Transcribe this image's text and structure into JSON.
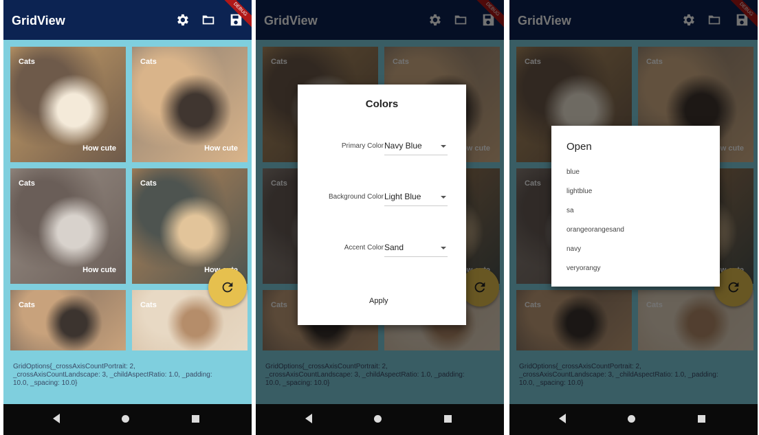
{
  "app": {
    "title": "GridView",
    "debug_banner": "DEBUG"
  },
  "grid": {
    "tiles": [
      {
        "caption_top": "Cats",
        "caption_bottom": "How cute",
        "colors": [
          "#c9a16a",
          "#6e5a4a",
          "#f4ead9"
        ]
      },
      {
        "caption_top": "Cats",
        "caption_bottom": "How cute",
        "colors": [
          "#8f8072",
          "#d9b48a",
          "#403630"
        ]
      },
      {
        "caption_top": "Cats",
        "caption_bottom": "How cute",
        "colors": [
          "#9a8f86",
          "#6a5e58",
          "#d8d2cc"
        ]
      },
      {
        "caption_top": "Cats",
        "caption_bottom": "How cute",
        "colors": [
          "#b58658",
          "#4e5450",
          "#e2c49a"
        ]
      },
      {
        "caption_top": "Cats",
        "caption_bottom": "",
        "colors": [
          "#7c6a5c",
          "#c8a27c",
          "#3c342f"
        ]
      },
      {
        "caption_top": "Cats",
        "caption_bottom": "",
        "colors": [
          "#d8c2a8",
          "#e8d9c4",
          "#b58d6a"
        ]
      }
    ]
  },
  "options_text": "GridOptions{_crossAxisCountPortrait: 2, _crossAxisCountLandscape: 3, _childAspectRatio: 1.0, _padding: 10.0, _spacing: 10.0}",
  "colors_dialog": {
    "title": "Colors",
    "primary_label": "Primary Color",
    "primary_value": "Navy Blue",
    "background_label": "Background Color",
    "background_value": "Light Blue",
    "accent_label": "Accent Color",
    "accent_value": "Sand",
    "apply_label": "Apply"
  },
  "open_dialog": {
    "title": "Open",
    "items": [
      "blue",
      "lightblue",
      "sa",
      "orangeorangesand",
      "navy",
      "veryorangy"
    ]
  },
  "theme": {
    "appbar": "#0c2352",
    "background": "#7fcfde",
    "fab": "#e6c04e"
  }
}
